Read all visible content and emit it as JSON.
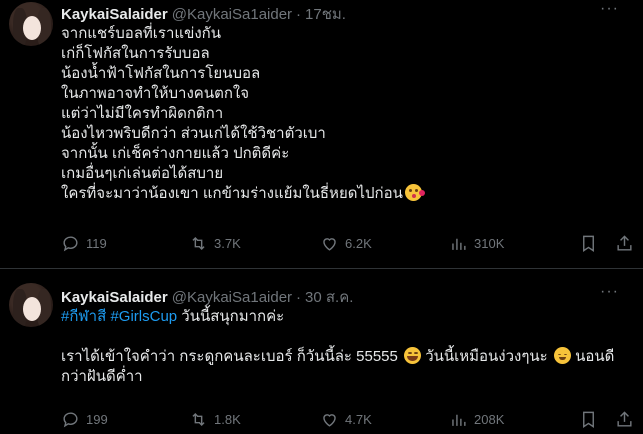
{
  "tweets": [
    {
      "name": "KaykaiSalaider",
      "handle": "@KaykaiSa1aider",
      "time": "17ชม.",
      "lines": [
        "จากแชร์บอลที่เราแข่งกัน",
        "เก่ก็โฟกัสในการรับบอล",
        "น้องน้ำฟ้าโฟกัสในการโยนบอล",
        "ในภาพอาจทำให้บางคนตกใจ",
        "แต่ว่าไม่มีใครทำผิดกติกา",
        "น้องไหวพริบดีกว่า ส่วนเก่ได้ใช้วิชาตัวเบา",
        "จากนั้น เก่เช็คร่างกายแล้ว ปกติดีค่ะ",
        "เกมอื่นๆเก่เล่นต่อได้สบาย",
        "ใครที่จะมาว่าน้องเขา แกข้ามร่างแย้มในธี่หยดไปก่อน"
      ],
      "emoji": "face-blowing-kiss",
      "stats": {
        "replies": "119",
        "reposts": "3.7K",
        "likes": "6.2K",
        "views": "310K"
      }
    },
    {
      "name": "KaykaiSalaider",
      "handle": "@KaykaiSa1aider",
      "time": "30 ส.ค.",
      "hashtag1": "#กีฬาสี",
      "hashtag2": "#GirlsCup",
      "line1_rest": " วันนี้สนุกมากค่ะ",
      "line2_text": "เราได้เข้าใจคำว่า กระดูกคนละเบอร์ ก็วันนี้ล่ะ 55555",
      "line2_mid": " วันนี้เหมือนง่วงๆนะ ",
      "line2_end": " นอนดี",
      "line3": "กว่าฝันดีค่ำา",
      "emoji_a": "rolling-on-floor-laughing",
      "emoji_b": "sleepy-face",
      "stats": {
        "replies": "199",
        "reposts": "1.8K",
        "likes": "4.7K",
        "views": "208K"
      }
    }
  ]
}
